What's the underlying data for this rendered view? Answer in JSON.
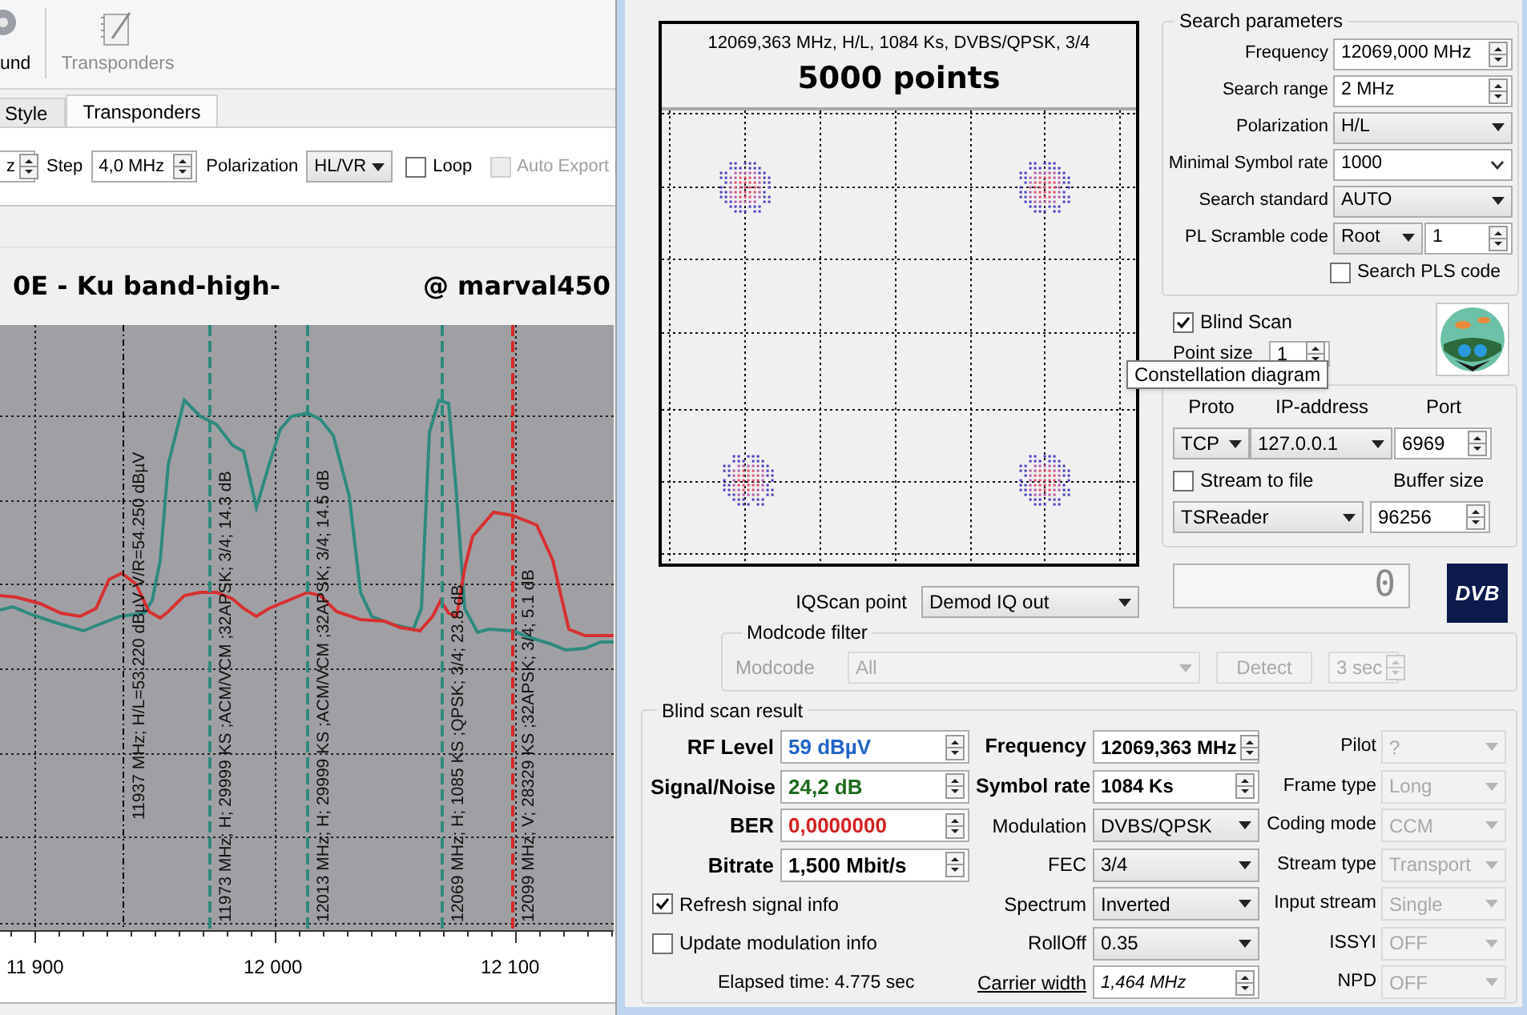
{
  "toolbar": {
    "items": [
      {
        "label": "und",
        "disabled": false
      },
      {
        "label": "Transponders",
        "disabled": true
      }
    ]
  },
  "tabs": [
    {
      "label": "Style",
      "selected": false
    },
    {
      "label": "Transponders",
      "selected": true
    }
  ],
  "scan_controls": {
    "start_value": "z",
    "step_label": "Step",
    "step_value": "4,0 MHz",
    "polarization_label": "Polarization",
    "polarization_value": "HL/VR",
    "loop": {
      "label": "Loop",
      "checked": false,
      "disabled": false
    },
    "auto_export": {
      "label": "Auto Export",
      "checked": false,
      "disabled": true
    }
  },
  "spectrum": {
    "title_left": "0E - Ku band-high-",
    "title_right": "@ marval450",
    "markers": [
      {
        "label": "11937 MHz;  H/L=53.220 dBµV  V/R=54.250 dBµV",
        "color": "#000000"
      },
      {
        "label": "11973 MHz; H; 29999 KS ;ACM/VCM ;32APSK; 3/4; 14.3 dB",
        "color": "#2e8a80"
      },
      {
        "label": "12013 MHz; H; 29999 KS ;ACM/VCM ;32APSK; 3/4; 14.5 dB",
        "color": "#2e8a80"
      },
      {
        "label": "12069 MHz; H; 1085 KS ;QPSK; 3/4; 23.8 dB",
        "color": "#2e8a80"
      },
      {
        "label": "12099 MHz; V; 28329 KS ;32APSK; 3/4; 5.1 dB",
        "color": "#d42a2a"
      }
    ],
    "x_ticks": [
      "11 900",
      "12 000",
      "12 100"
    ]
  },
  "constellation": {
    "caption": "12069,363 MHz, H/L, 1084 Ks, DVBS/QPSK, 3/4",
    "title": "5000 points",
    "tooltip": "Constellation diagram",
    "iqscan_label": "IQScan point",
    "iqscan_value": "Demod IQ out"
  },
  "search_parameters": {
    "title": "Search parameters",
    "rows": [
      {
        "label": "Frequency",
        "kind": "spin",
        "value": "12069,000 MHz"
      },
      {
        "label": "Search range",
        "kind": "spin",
        "value": "2 MHz"
      },
      {
        "label": "Polarization",
        "kind": "select",
        "value": "H/L"
      },
      {
        "label": "Minimal Symbol rate",
        "kind": "combo",
        "value": "1000"
      },
      {
        "label": "Search standard",
        "kind": "select",
        "value": "AUTO"
      },
      {
        "label": "PL Scramble code",
        "kind": "select_spin",
        "value": "Root",
        "value2": "1"
      }
    ],
    "search_pls": {
      "label": "Search PLS code",
      "checked": false
    }
  },
  "blind_scan": {
    "label": "Blind Scan",
    "checked": true
  },
  "point_size": {
    "label": "Point size",
    "value": "1"
  },
  "streaming": {
    "headers": [
      "Proto",
      "IP-address",
      "Port"
    ],
    "proto": "TCP",
    "ip": "127.0.0.1",
    "port": "6969",
    "stream_to_file": {
      "label": "Stream to file",
      "checked": false
    },
    "buffer_label": "Buffer size",
    "reader": "TSReader",
    "buffer": "96256"
  },
  "lcd": "0",
  "dvb_logo": "DVB",
  "modcode_filter": {
    "title": "Modcode filter",
    "label": "Modcode",
    "value": "All",
    "detect": "Detect",
    "timeout": "3 sec",
    "disabled": true
  },
  "result": {
    "title": "Blind scan result",
    "signal": [
      {
        "label": "RF Level",
        "value": "59 dBµV",
        "color": "#1f63c6"
      },
      {
        "label": "Signal/Noise",
        "value": "24,2 dB",
        "color": "#1e6b1e"
      },
      {
        "label": "BER",
        "value": "0,0000000",
        "color": "#d42020"
      },
      {
        "label": "Bitrate",
        "value": "1,500 Mbit/s",
        "color": "#000000"
      }
    ],
    "options": [
      {
        "label": "Refresh signal info",
        "checked": true
      },
      {
        "label": "Update modulation info",
        "checked": false
      }
    ],
    "elapsed": "Elapsed time: 4.775 sec",
    "params": [
      {
        "label": "Frequency",
        "kind": "spin",
        "value": "12069,363 MHz",
        "bold": true
      },
      {
        "label": "Symbol rate",
        "kind": "spin",
        "value": "1084 Ks",
        "bold": true
      },
      {
        "label": "Modulation",
        "kind": "select",
        "value": "DVBS/QPSK",
        "bold": false
      },
      {
        "label": "FEC",
        "kind": "select",
        "value": "3/4",
        "bold": false
      },
      {
        "label": "Spectrum",
        "kind": "select",
        "value": "Inverted",
        "bold": false
      },
      {
        "label": "RollOff",
        "kind": "select",
        "value": "0.35",
        "bold": false
      },
      {
        "label": "Carrier width",
        "kind": "link_spin",
        "value": "1,464 MHz",
        "bold": false
      }
    ],
    "extra": [
      {
        "label": "Pilot",
        "value": "?",
        "disabled": true
      },
      {
        "label": "Frame type",
        "value": "Long",
        "disabled": true
      },
      {
        "label": "Coding mode",
        "value": "CCM",
        "disabled": true
      },
      {
        "label": "Stream type",
        "value": "Transport",
        "disabled": true
      },
      {
        "label": "Input stream",
        "value": "Single",
        "disabled": true
      },
      {
        "label": "ISSYI",
        "value": "OFF",
        "disabled": true
      },
      {
        "label": "NPD",
        "value": "OFF",
        "disabled": true
      }
    ]
  }
}
